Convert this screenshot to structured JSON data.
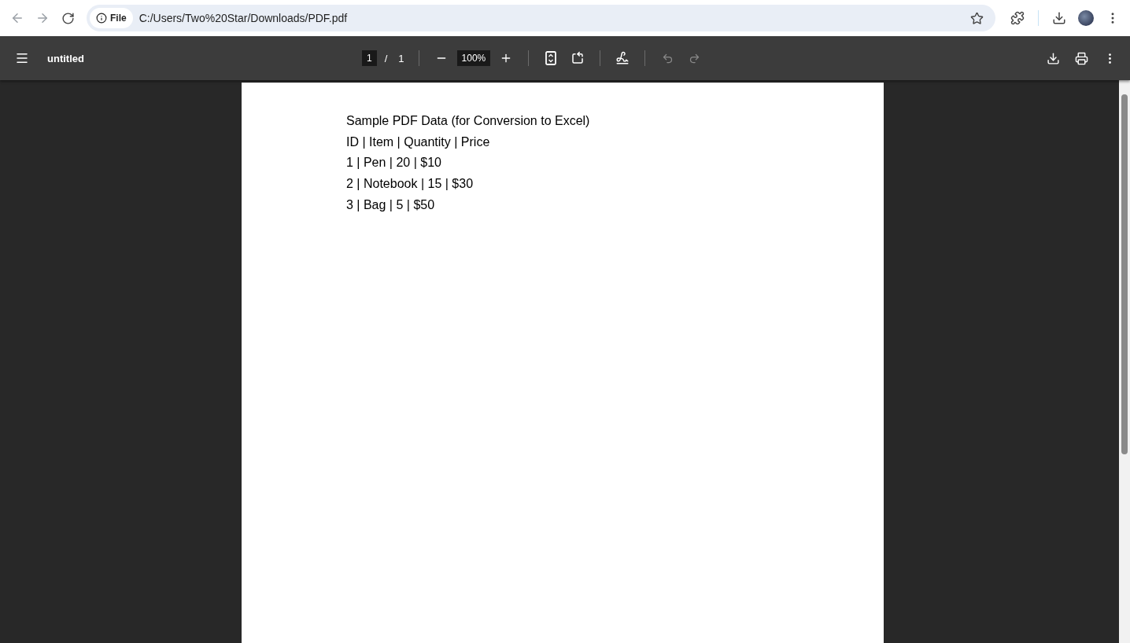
{
  "browser": {
    "back": {
      "disabled": true
    },
    "forward": {
      "disabled": true
    },
    "site_label": "File",
    "url": "C:/Users/Two%20Star/Downloads/PDF.pdf"
  },
  "viewer": {
    "title": "untitled",
    "page_current": "1",
    "page_separator": "/",
    "page_total": "1",
    "zoom": "100%",
    "undo": {
      "disabled": true
    },
    "redo": {
      "disabled": true
    }
  },
  "document": {
    "lines": [
      "Sample PDF Data (for Conversion to Excel)",
      "ID | Item | Quantity | Price",
      "1 | Pen | 20 | $10",
      "2 | Notebook | 15 | $30",
      "3 | Bag | 5 | $50"
    ]
  }
}
